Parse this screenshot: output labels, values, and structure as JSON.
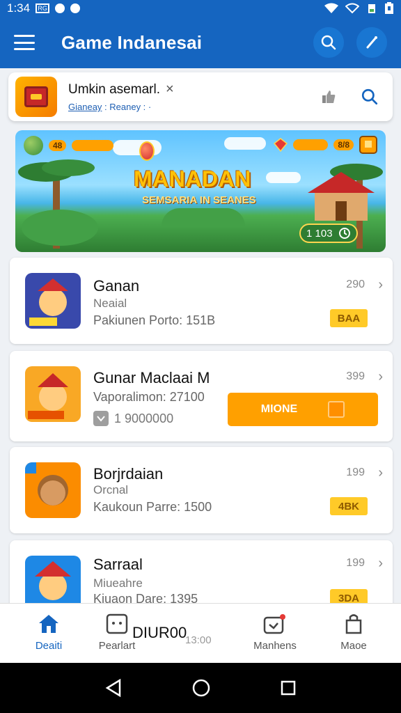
{
  "status_bar": {
    "time": "1:34",
    "box_label": "RG"
  },
  "app_bar": {
    "title": "Game Indanesai"
  },
  "search_card": {
    "title": "Umkin asemarl.",
    "close_glyph": "×",
    "subtitle_link": "Gianeay",
    "subtitle_rest": " : Reaney : ·"
  },
  "banner": {
    "title": "MANADAN",
    "subtitle": "SEMSARIA IN SEANES",
    "hud_left_value": "48",
    "hud_right_value": "8/8",
    "badge_value": "1 103"
  },
  "games": [
    {
      "name": "Ganan",
      "line2": "Neaial",
      "line3": "Pakiunen Porto: 151B",
      "count": "290",
      "action": "BAA"
    },
    {
      "name": "Gunar Maclaai M",
      "line2": "Vaporalimon: 27100",
      "line3": "1 9000000",
      "count": "399",
      "action": "MIONE"
    },
    {
      "name": "Borjrdaian",
      "line2": "Orcnal",
      "line3": "Kaukoun Parre: 1500",
      "count": "199",
      "action": "4BK"
    },
    {
      "name": "Sarraal",
      "line2": "Miueahre",
      "line3": "Kiuaon Dare: 1395",
      "count": "199",
      "action": "3DA"
    }
  ],
  "floating": {
    "text": "DIUR00",
    "number": "13:00"
  },
  "bottom_nav": [
    {
      "label": "Deaiti",
      "icon": "home-icon",
      "active": true
    },
    {
      "label": "Pearlart",
      "icon": "controller-icon",
      "active": false
    },
    {
      "label": "Manhens",
      "icon": "inbox-icon",
      "active": false
    },
    {
      "label": "Maoe",
      "icon": "bag-icon",
      "active": false
    }
  ],
  "colors": {
    "primary": "#1565c0",
    "accent": "#ffa000",
    "badge": "#ffca28"
  }
}
